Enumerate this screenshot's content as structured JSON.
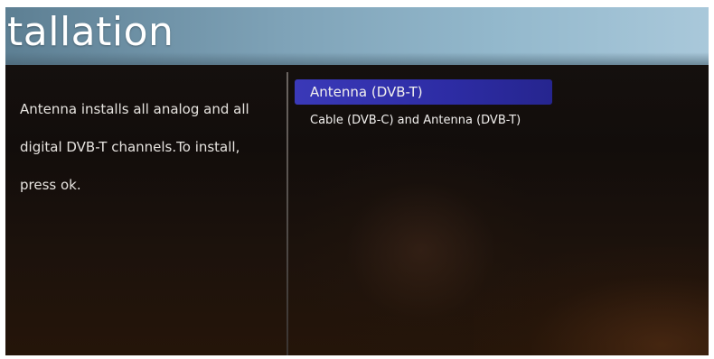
{
  "header": {
    "title": "tallation"
  },
  "info_panel": {
    "lines": [
      "Antenna installs all analog and all",
      "digital DVB-T channels.To install,",
      "press ok."
    ]
  },
  "options": [
    {
      "label": "Antenna (DVB-T)",
      "selected": true
    },
    {
      "label": "Cable (DVB-C) and Antenna (DVB-T)",
      "selected": false
    }
  ],
  "colors": {
    "title_bar": "#7fa3b8",
    "selection_highlight": "#3a39b8",
    "background": "#141010",
    "text": "#e6e3df"
  }
}
